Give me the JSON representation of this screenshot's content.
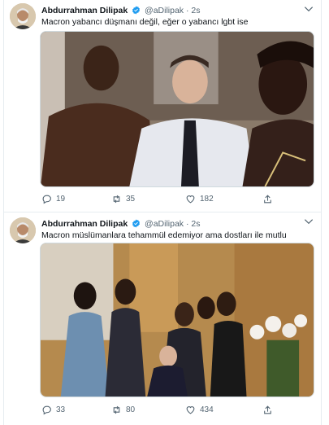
{
  "tweets": [
    {
      "author_name": "Abdurrahman Dilipak",
      "handle": "@aDilipak",
      "separator": "·",
      "time": "2s",
      "text": "Macron yabancı düşmanı değil, eğer o yabancı lgbt ise",
      "replies": "19",
      "retweets": "35",
      "likes": "182"
    },
    {
      "author_name": "Abdurrahman Dilipak",
      "handle": "@aDilipak",
      "separator": "·",
      "time": "2s",
      "text": "Macron müslümanlara tehammül edemiyor ama dostları ile mutlu",
      "replies": "33",
      "retweets": "80",
      "likes": "434"
    }
  ],
  "icons": {
    "verified": "verified-badge-icon",
    "more": "chevron-down-icon",
    "reply": "reply-icon",
    "retweet": "retweet-icon",
    "like": "heart-icon",
    "share": "share-icon"
  },
  "colors": {
    "accent": "#1d9bf0",
    "text": "#0f1419",
    "muted": "#536471",
    "border": "#e6ecf0"
  }
}
